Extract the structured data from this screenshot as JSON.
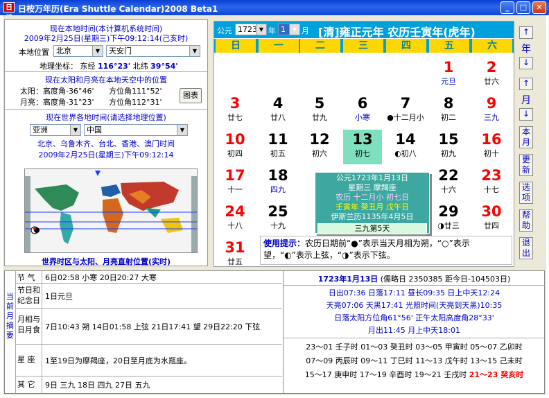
{
  "window": {
    "title": "日桉万年历(Era Shuttle Calendar)2008 Beta1",
    "icon": "日桉"
  },
  "left": {
    "local_title": "现在本地时间(本计算机系统时间)",
    "local_time": "2009年2月25日(星期三)下午09:12:14(己亥时)",
    "loc_label": "本地位置",
    "city": "北京",
    "place": "天安门",
    "coord_label": "地理坐标：",
    "lon_label": "东经",
    "lon": "116°23'",
    "lat_label": "北纬",
    "lat": "39°54'",
    "sun_title": "现在太阳和月亮在本地天空中的位置",
    "sun": "太阳：高度角-36°46'",
    "sun_az": "方位角111°52'",
    "moon": "月亮：高度角-31°23'",
    "moon_az": "方位角112°31'",
    "chart_btn": "图表",
    "world_title": "现在世界各地时间(请选择地理位置)",
    "region": "亚洲",
    "country": "中国",
    "cities": "北京、乌鲁木齐、台北、香港、澳门时间",
    "world_time": "2009年2月25日(星期三)下午09:12:14",
    "map_caption": "世界时区与太阳、月亮直射位置",
    "map_caption_bold": "(实时)"
  },
  "header": {
    "era_label": "公元",
    "year": "1723",
    "year_unit": "年",
    "month": "1",
    "month_unit": "月",
    "title": "[清]雍正元年  农历壬寅年(虎年)"
  },
  "weekdays": [
    "日",
    "一",
    "二",
    "三",
    "四",
    "五",
    "六"
  ],
  "days": [
    {
      "n": "1",
      "s": "元旦",
      "col": 5,
      "row": 0,
      "color": "#ff0000",
      "scolor": "#0000c8"
    },
    {
      "n": "2",
      "s": "廿六",
      "col": 6,
      "row": 0,
      "color": "#ff0000",
      "scolor": "#000"
    },
    {
      "n": "3",
      "s": "廿七",
      "col": 0,
      "row": 1,
      "color": "#ff0000",
      "scolor": "#000"
    },
    {
      "n": "4",
      "s": "廿八",
      "col": 1,
      "row": 1,
      "color": "#000",
      "scolor": "#000"
    },
    {
      "n": "5",
      "s": "廿九",
      "col": 2,
      "row": 1,
      "color": "#000",
      "scolor": "#000"
    },
    {
      "n": "6",
      "s": "小寒",
      "col": 3,
      "row": 1,
      "color": "#000",
      "scolor": "#0000c8"
    },
    {
      "n": "7",
      "s": "●十二月小",
      "col": 4,
      "row": 1,
      "color": "#000",
      "scolor": "#000"
    },
    {
      "n": "8",
      "s": "初二",
      "col": 5,
      "row": 1,
      "color": "#000",
      "scolor": "#000"
    },
    {
      "n": "9",
      "s": "三九",
      "col": 6,
      "row": 1,
      "color": "#ff0000",
      "scolor": "#0000c8"
    },
    {
      "n": "10",
      "s": "初四",
      "col": 0,
      "row": 2,
      "color": "#ff0000",
      "scolor": "#000"
    },
    {
      "n": "11",
      "s": "初五",
      "col": 1,
      "row": 2,
      "color": "#000",
      "scolor": "#000"
    },
    {
      "n": "12",
      "s": "初六",
      "col": 2,
      "row": 2,
      "color": "#000",
      "scolor": "#000"
    },
    {
      "n": "13",
      "s": "初七",
      "col": 3,
      "row": 2,
      "color": "#000",
      "scolor": "#000",
      "sel": true
    },
    {
      "n": "14",
      "s": "◐初八",
      "col": 4,
      "row": 2,
      "color": "#000",
      "scolor": "#000"
    },
    {
      "n": "15",
      "s": "初九",
      "col": 5,
      "row": 2,
      "color": "#000",
      "scolor": "#000"
    },
    {
      "n": "16",
      "s": "初十",
      "col": 6,
      "row": 2,
      "color": "#ff0000",
      "scolor": "#000"
    },
    {
      "n": "17",
      "s": "十一",
      "col": 0,
      "row": 3,
      "color": "#ff0000",
      "scolor": "#000"
    },
    {
      "n": "18",
      "s": "四九",
      "col": 1,
      "row": 3,
      "color": "#000",
      "scolor": "#0000c8"
    },
    {
      "n": "22",
      "s": "十六",
      "col": 5,
      "row": 3,
      "color": "#000",
      "scolor": "#000"
    },
    {
      "n": "23",
      "s": "十七",
      "col": 6,
      "row": 3,
      "color": "#ff0000",
      "scolor": "#000"
    },
    {
      "n": "24",
      "s": "十八",
      "col": 0,
      "row": 4,
      "color": "#ff0000",
      "scolor": "#000"
    },
    {
      "n": "25",
      "s": "十九",
      "col": 1,
      "row": 4,
      "color": "#000",
      "scolor": "#000"
    },
    {
      "n": "29",
      "s": "◑廿三",
      "col": 5,
      "row": 4,
      "color": "#000",
      "scolor": "#000"
    },
    {
      "n": "30",
      "s": "廿四",
      "col": 6,
      "row": 4,
      "color": "#ff0000",
      "scolor": "#000"
    },
    {
      "n": "31",
      "s": "廿五",
      "col": 0,
      "row": 5,
      "color": "#ff0000",
      "scolor": "#000"
    }
  ],
  "popup": {
    "l1": "公元1723年1月13日",
    "l2": "星期三 摩羯座",
    "l3": "农历 十二月小 初七日",
    "l4": "壬寅年 癸丑月 戊午日",
    "l5": "伊斯兰历1135年4月5日",
    "l6": "三九第5天"
  },
  "tip": {
    "bold": "使用提示：",
    "text": "农历日期前“●”表示当天月相为朔，“○”表示望，“◐”表示上弦，“◑”表示下弦。"
  },
  "side": {
    "year_label": "年",
    "month_label": "月",
    "this_month": "本月",
    "update": "更新",
    "options": "选项",
    "help": "帮助",
    "exit": "退出",
    "up": "↑",
    "down": "↓"
  },
  "bottom": {
    "vertical": "当前月摘要",
    "rows": [
      {
        "k": "节 气",
        "v": "6日02:58 小寒    20日20:27 大寒"
      },
      {
        "k": "节日和纪念日",
        "v": "1日元旦"
      },
      {
        "k": "月相与日月食",
        "v": "7日10:43 朔  14日01:58 上弦  21日17:41 望  29日22:20 下弦"
      },
      {
        "k": "星 座",
        "v": "1至19日为摩羯座，20日至月底为水瓶座。"
      },
      {
        "k": "其 它",
        "v": "9日 三九  18日 四九  27日 五九"
      }
    ],
    "date_line": "1723年1月13日",
    "jd": "(儒略日 2350385  距今日-104503日)",
    "sun1": "日出07:36  日落17:11  昼长09:35  日上中天12:24",
    "sun2": "天亮07:06  天黑17:41  光照时间(天亮到天黑)10:35",
    "sun3": "日落太阳方位角61°56'  正午太阳高度角28°33'",
    "moon1": "月出11:45  月上中天18:01",
    "h1": "23～01 壬子时  01～03 癸丑时  03～05 甲寅时  05～07 乙卯时",
    "h2": "07～09 丙辰时  09～11 丁巳时  11～13 戊午时  13～15 己未时",
    "h3a": "15～17 庚申时  17～19 辛酉时  19～21 壬戌时  ",
    "h3b": "21～23 癸亥时"
  },
  "colors": {
    "accent": "#00a0dc",
    "weekday_bg": "#ffd700",
    "highlight": "#7fe0c0",
    "popup": "#3ca8a0"
  }
}
